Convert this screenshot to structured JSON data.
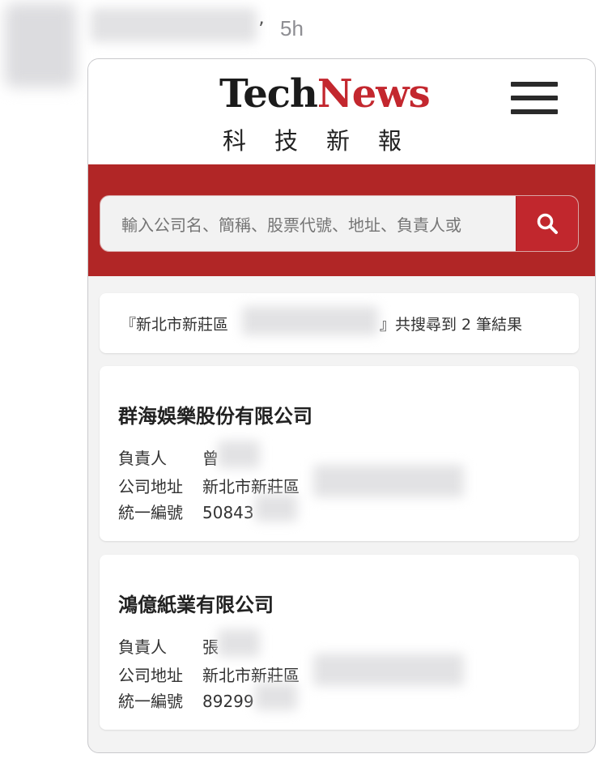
{
  "post": {
    "time": "5h"
  },
  "site": {
    "logo_en_part1": "Tech",
    "logo_en_part2": "News",
    "logo_zh": "科技新報",
    "brand_color": "#b12626"
  },
  "search": {
    "placeholder": "輸入公司名、簡稱、股票代號、地址、負責人或"
  },
  "results": {
    "summary_open": "『新北市新莊區",
    "summary_close": "』共搜尋到 2 筆結果",
    "companies": [
      {
        "name": "群海娛樂股份有限公司",
        "person_label": "負責人",
        "person_value": "曾",
        "address_label": "公司地址",
        "address_value": "新北市新莊區",
        "tax_label": "統一編號",
        "tax_value": "50843"
      },
      {
        "name": "鴻億紙業有限公司",
        "person_label": "負責人",
        "person_value": "張",
        "address_label": "公司地址",
        "address_value": "新北市新莊區",
        "tax_label": "統一編號",
        "tax_value": "89299"
      }
    ]
  },
  "icons": {
    "menu": "hamburger-menu-icon",
    "search": "search-icon"
  }
}
